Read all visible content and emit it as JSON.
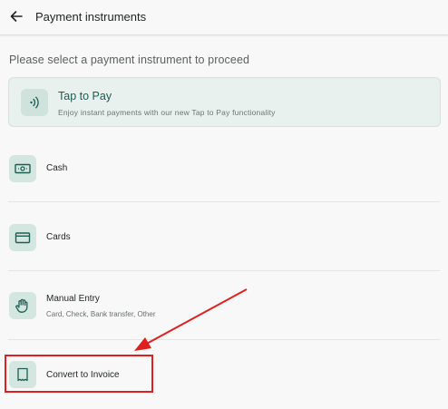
{
  "header": {
    "title": "Payment instruments"
  },
  "subtitle": "Please select a payment instrument to proceed",
  "tap_to_pay": {
    "title": "Tap to Pay",
    "description": "Enjoy instant payments with our new Tap to Pay functionality"
  },
  "instruments": [
    {
      "label": "Cash",
      "icon": "cash-icon"
    },
    {
      "label": "Cards",
      "icon": "card-icon"
    },
    {
      "label": "Manual Entry",
      "sublabel": "Card, Check, Bank transfer, Other",
      "icon": "hand-icon"
    },
    {
      "label": "Convert to Invoice",
      "icon": "invoice-icon"
    }
  ],
  "colors": {
    "accent": "#165f52",
    "icon_bg": "#d3e6df",
    "annotation": "#e02020"
  }
}
